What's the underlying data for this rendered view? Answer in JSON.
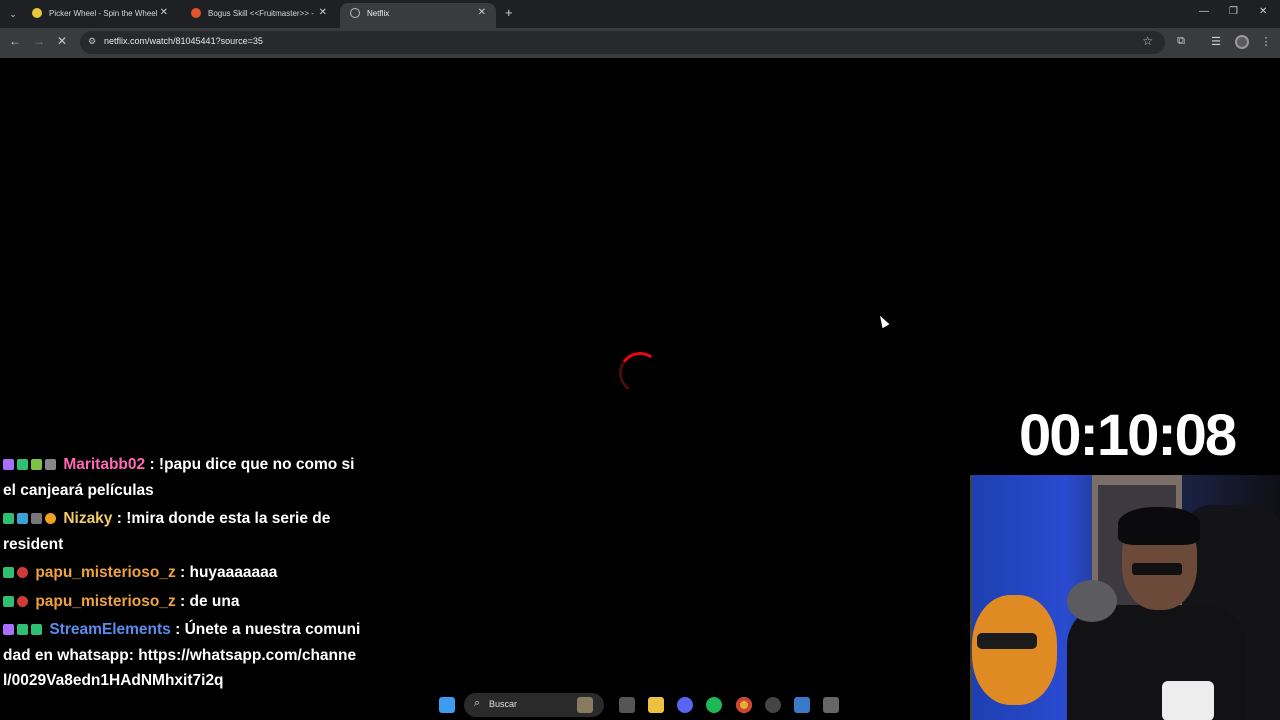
{
  "browser": {
    "tabs": [
      {
        "title": "Picker Wheel - Spin the Wheel",
        "active": false
      },
      {
        "title": "Bogus Skill <<Fruitmaster>> -",
        "active": false
      },
      {
        "title": "Netflix",
        "active": true
      }
    ],
    "url": "netflix.com/watch/81045441?source=35"
  },
  "timer": "00:10:08",
  "chat": [
    {
      "user": "Maritabb02",
      "color": "#ff69b4",
      "text": " : !papu dice que no como si el canjeará películas"
    },
    {
      "user": "Nizaky",
      "color": "#f5c96a",
      "text": " : !mira donde esta la serie de resident"
    },
    {
      "user": "papu_misterioso_z",
      "color": "#f0a23c",
      "text": " : huyaaaaaaa"
    },
    {
      "user": "papu_misterioso_z",
      "color": "#f0a23c",
      "text": " : de una"
    },
    {
      "user": "StreamElements",
      "color": "#5b8def",
      "text": " : Únete a nuestra comunidad en whatsapp: https://whatsapp.com/channel/0029Va8edn1HAdNMhxit7i2q"
    }
  ],
  "taskbar": {
    "search_label": "Buscar"
  },
  "colors": {
    "netflix_red": "#e50914"
  }
}
